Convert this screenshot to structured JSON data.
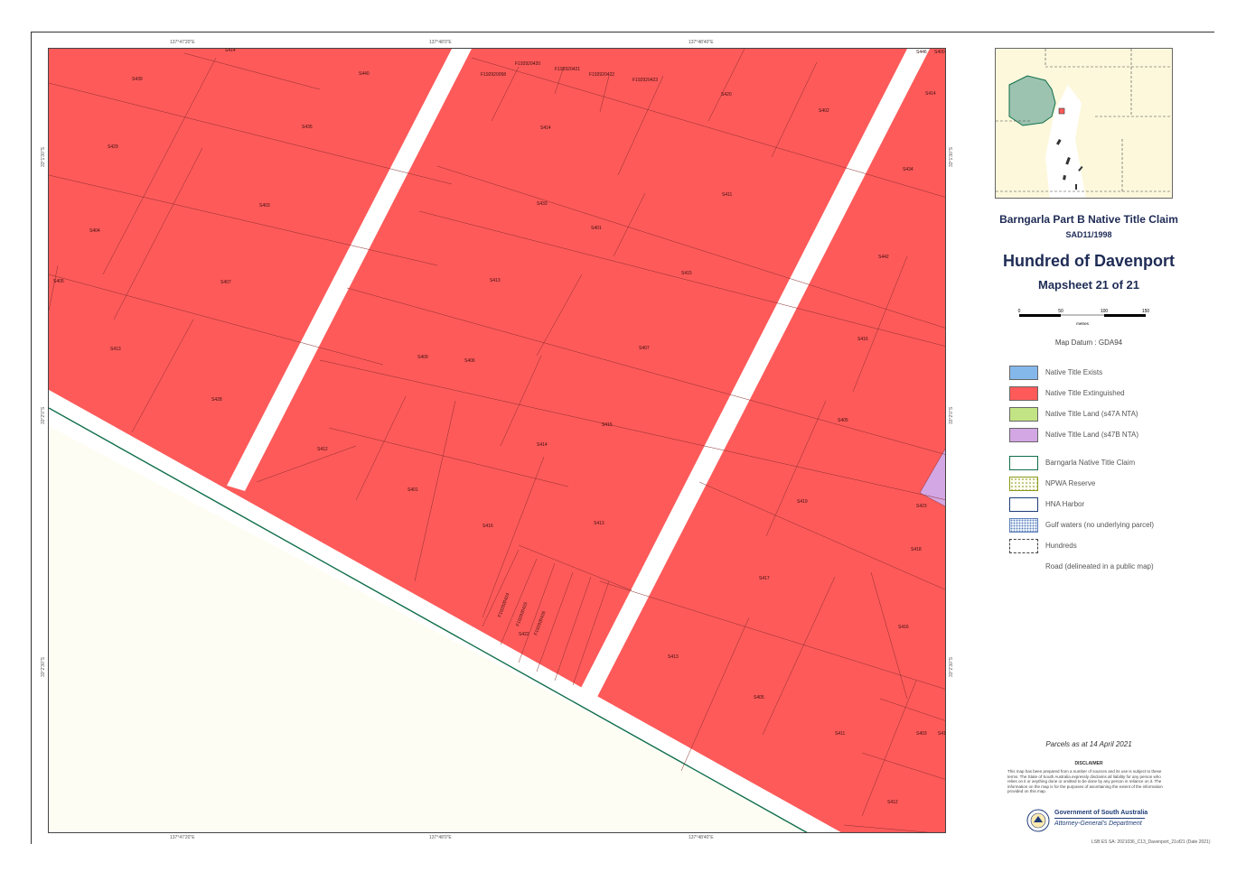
{
  "map": {
    "colors": {
      "extinguished": "#fe5a5a",
      "nta_47b": "#d3a6e4",
      "land_fill": "#fdfdf3",
      "road": "#ffffff",
      "claim_line": "#0f6e4a",
      "parcel_line": "#8a2e2e"
    },
    "parcel_labels": [
      "S439",
      "S440",
      "S414",
      "S429",
      "S435",
      "S414",
      "S403",
      "S404",
      "S407",
      "S405",
      "S406",
      "S413",
      "S433",
      "S420",
      "S402",
      "S414",
      "S411",
      "S434",
      "S415",
      "S442",
      "S407",
      "S409",
      "S416",
      "S415",
      "S405",
      "S412",
      "S428",
      "S413",
      "S401",
      "S416",
      "S413",
      "S419",
      "S423",
      "S418",
      "S417",
      "S416",
      "S413",
      "S405",
      "S411",
      "S403",
      "S412",
      "S418",
      "S400",
      "S446",
      "S401",
      "S414",
      "S422"
    ],
    "allotment_labels": [
      "F192920058",
      "F192920420",
      "F192920421",
      "F192920422",
      "F192920423",
      "F192920424",
      "F192920425",
      "F192920426"
    ],
    "coord_ticks_top": [
      "137°47'20\"E",
      "137°48'0\"E",
      "137°48'40\"E"
    ],
    "coord_ticks_bottom": [
      "137°47'20\"E",
      "137°48'0\"E",
      "137°48'40\"E"
    ],
    "coord_ticks_left": [
      "33°1'30\"S",
      "33°2'0\"S",
      "33°2'30\"S"
    ],
    "coord_ticks_right": [
      "33°1'30\"S",
      "33°2'0\"S",
      "33°2'30\"S"
    ]
  },
  "panel": {
    "claim_title": "Barngarla Part B Native Title Claim",
    "claim_id": "SAD11/1998",
    "hundred": "Hundred of Davenport",
    "mapsheet": "Mapsheet 21 of 21",
    "scale": {
      "ticks": [
        "0",
        "50",
        "100",
        "150"
      ],
      "unit": "metres"
    },
    "datum": "Map Datum : GDA94",
    "legend": [
      {
        "label": "Native Title Exists",
        "color": "#85b8ea",
        "style": "fill"
      },
      {
        "label": "Native Title Extinguished",
        "color": "#fe5a5a",
        "style": "fill"
      },
      {
        "label": "Native Title Land (s47A NTA)",
        "color": "#c3e484",
        "style": "fill"
      },
      {
        "label": "Native Title Land (s47B NTA)",
        "color": "#d3a6e4",
        "style": "fill"
      },
      {
        "label": "Barngarla Native Title Claim",
        "color": "#0f6e4a",
        "style": "outline"
      },
      {
        "label": "NPWA Reserve",
        "color": "#8a9a1a",
        "style": "dotted"
      },
      {
        "label": "HNA Harbor",
        "color": "#1e3c78",
        "style": "outline"
      },
      {
        "label": "Gulf waters (no underlying parcel)",
        "color": "#5c7fb8",
        "style": "speckle"
      },
      {
        "label": "Hundreds",
        "color": "#444444",
        "style": "dashed"
      },
      {
        "label": "Road (delineated in a public map)",
        "color": "#ffffff",
        "style": "none"
      }
    ],
    "parcels_date": "Parcels as at 14 April 2021",
    "disclaimer_title": "DISCLAIMER",
    "disclaimer_text": "This map has been prepared from a number of sources and its use is subject to these terms. The State of South Australia expressly disclaims all liability for any person who relies on it or anything done or omitted to be done by any person in reliance on it. The information on the map is for the purposes of ascertaining the extent of the information provided on this map.",
    "gov_name": "Government of South Australia",
    "gov_dept": "Attorney-General's Department",
    "file_ref": "LSB ES SA: 2021036_C13_Davenport_21of21 (Date 2021)"
  }
}
